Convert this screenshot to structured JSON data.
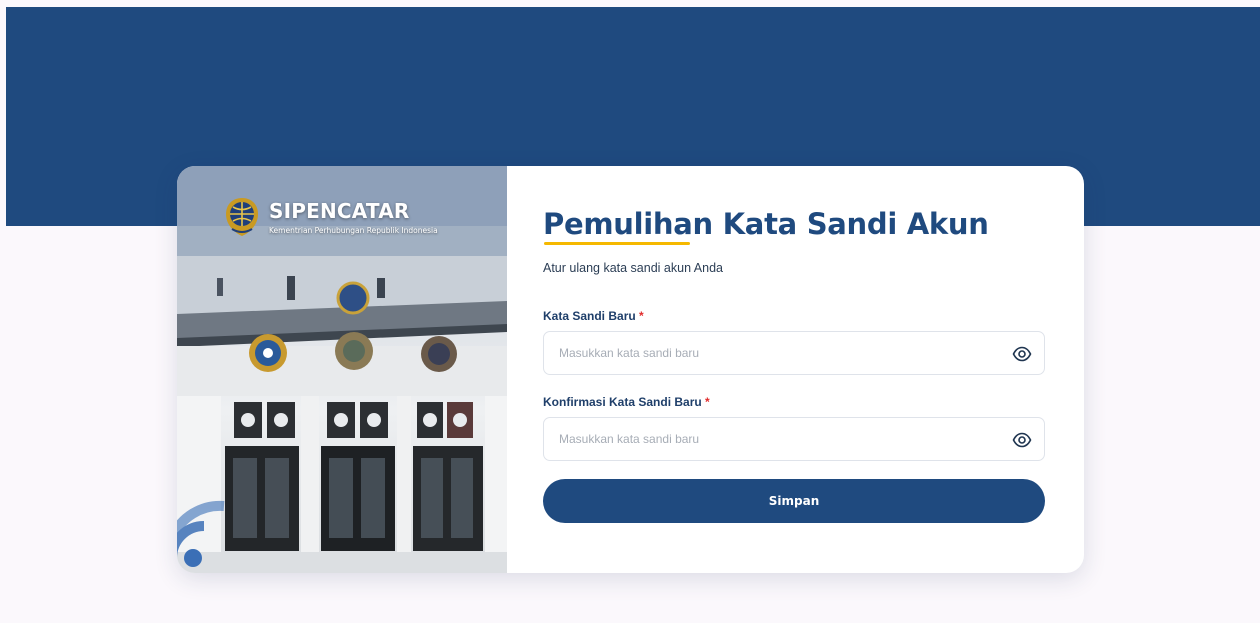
{
  "brand": {
    "name": "SIPENCATAR",
    "subtitle": "Kementrian Perhubungan Republik Indonesia",
    "logo_icon": "kemenhub-emblem-icon"
  },
  "form": {
    "title": "Pemulihan Kata Sandi Akun",
    "subtitle": "Atur ulang kata sandi akun Anda",
    "new_password": {
      "label": "Kata Sandi Baru",
      "required_mark": "*",
      "placeholder": "Masukkan kata sandi baru",
      "value": "",
      "toggle_icon": "eye-icon"
    },
    "confirm_password": {
      "label": "Konfirmasi Kata Sandi Baru",
      "required_mark": "*",
      "placeholder": "Masukkan kata sandi baru",
      "value": "",
      "toggle_icon": "eye-icon"
    },
    "submit_label": "Simpan"
  },
  "colors": {
    "primary": "#1f4a7f",
    "accent": "#f5b800",
    "required": "#e12d2d",
    "page_bg": "#fbf8fc"
  }
}
